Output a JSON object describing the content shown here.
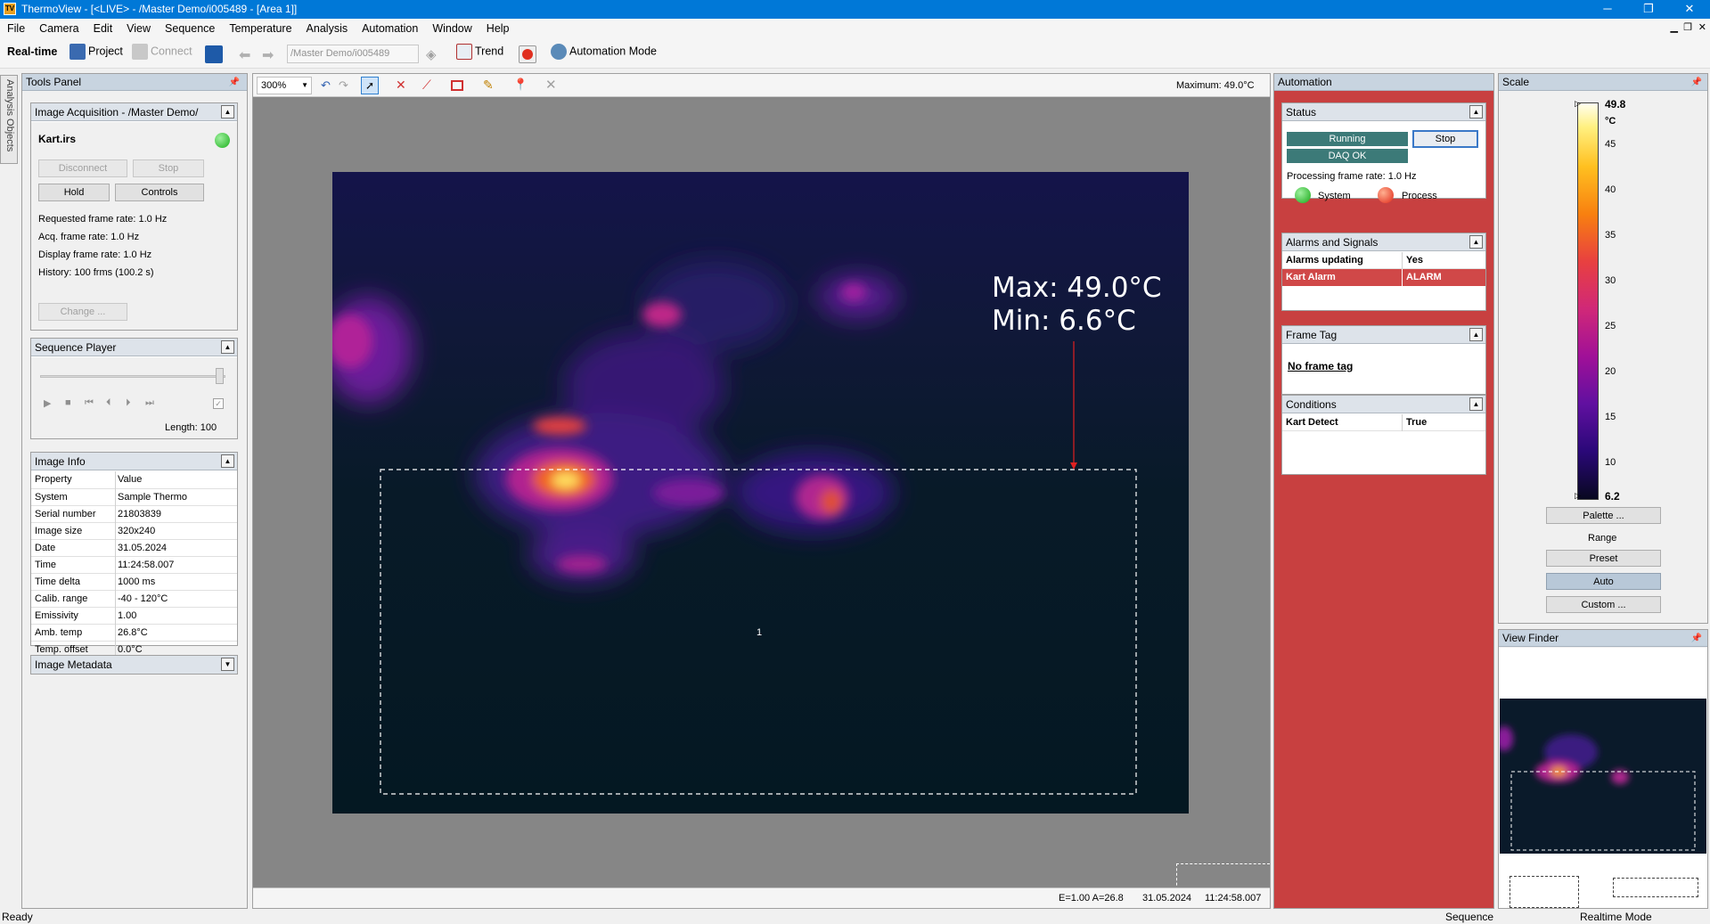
{
  "window": {
    "title": "ThermoView - [<LIVE> - /Master Demo/i005489 - [Area 1]]",
    "app_icon": "TV"
  },
  "menu": [
    "File",
    "Camera",
    "Edit",
    "View",
    "Sequence",
    "Temperature",
    "Analysis",
    "Automation",
    "Window",
    "Help"
  ],
  "toolbar": {
    "realtime": "Real-time",
    "project": "Project",
    "connect": "Connect",
    "path": "/Master Demo/i005489",
    "trend": "Trend",
    "automation_mode": "Automation Mode"
  },
  "side_tab": "Analysis Objects",
  "tools_panel": {
    "title": "Tools Panel",
    "acq": {
      "title": "Image Acquisition - /Master Demo/",
      "file": "Kart.irs",
      "disconnect": "Disconnect",
      "stop": "Stop",
      "hold": "Hold",
      "controls": "Controls",
      "req_rate": "Requested frame rate: 1.0 Hz",
      "acq_rate": "Acq. frame rate: 1.0 Hz",
      "disp_rate": "Display frame rate: 1.0 Hz",
      "history": "History: 100 frms (100.2 s)",
      "change": "Change ..."
    },
    "seq": {
      "title": "Sequence Player",
      "length": "Length: 100"
    },
    "info": {
      "title": "Image Info",
      "col_prop": "Property",
      "col_val": "Value",
      "rows": [
        [
          "System",
          "Sample Thermo"
        ],
        [
          "Serial number",
          "21803839"
        ],
        [
          "Image size",
          "320x240"
        ],
        [
          "Date",
          "31.05.2024"
        ],
        [
          "Time",
          "11:24:58.007"
        ],
        [
          "Time delta",
          "1000 ms"
        ],
        [
          "Calib. range",
          "-40 - 120°C"
        ],
        [
          "Emissivity",
          "1.00"
        ],
        [
          "Amb. temp",
          "26.8°C"
        ],
        [
          "Temp. offset",
          "0.0°C"
        ]
      ]
    },
    "meta": {
      "title": "Image Metadata"
    }
  },
  "viewer": {
    "zoom": "300%",
    "maximum": "Maximum: 49.0°C",
    "overlay_max": "Max: 49.0°C",
    "overlay_min": "Min:  6.6°C",
    "area_label": "1",
    "status_e": "E=1.00 A=26.8",
    "status_date": "31.05.2024",
    "status_time": "11:24:58.007"
  },
  "automation": {
    "title": "Automation",
    "status": {
      "title": "Status",
      "running": "Running",
      "stop": "Stop",
      "daq": "DAQ OK",
      "rate": "Processing frame rate: 1.0 Hz",
      "system": "System",
      "process": "Process"
    },
    "alarms": {
      "title": "Alarms and Signals",
      "rows": [
        [
          "Alarms updating",
          "Yes"
        ],
        [
          "Kart Alarm",
          "ALARM"
        ]
      ]
    },
    "frametag": {
      "title": "Frame Tag",
      "value": "No frame tag"
    },
    "conditions": {
      "title": "Conditions",
      "rows": [
        [
          "Kart Detect",
          "True"
        ]
      ]
    }
  },
  "scale": {
    "title": "Scale",
    "max": "49.8",
    "unit": "°C",
    "ticks": [
      "45",
      "40",
      "35",
      "30",
      "25",
      "20",
      "15",
      "10"
    ],
    "min": "6.2",
    "palette": "Palette ...",
    "range": "Range",
    "preset": "Preset",
    "auto": "Auto",
    "custom": "Custom ..."
  },
  "viewfinder": {
    "title": "View Finder"
  },
  "statusbar": {
    "ready": "Ready",
    "sequence": "Sequence",
    "mode": "Realtime Mode"
  },
  "colors": {
    "accent": "#0078d7",
    "automation_bg": "#c84040",
    "alarm": "#d04848",
    "running": "#3c7a78"
  }
}
